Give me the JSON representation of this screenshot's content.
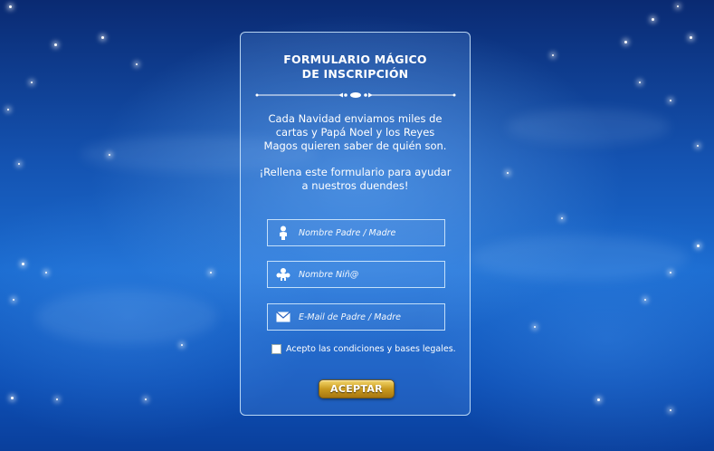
{
  "form": {
    "title_line1": "FORMULARIO MÁGICO",
    "title_line2": "DE INSCRIPCIÓN",
    "intro_paragraph1": "Cada Navidad enviamos miles de cartas y Papá Noel y los Reyes Magos quieren saber de quién son.",
    "intro_paragraph2": "¡Rellena este formulario para ayudar a nuestros duendes!",
    "fields": [
      {
        "placeholder": "Nombre Padre / Madre",
        "icon": "parent-icon",
        "value": ""
      },
      {
        "placeholder": "Nombre Niñ@",
        "icon": "child-icon",
        "value": ""
      },
      {
        "placeholder": "E-Mail de Padre / Madre",
        "icon": "envelope-icon",
        "value": ""
      }
    ],
    "terms_label": "Acepto las condiciones y bases legales.",
    "terms_checked": false,
    "submit_label": "ACEPTAR"
  },
  "colors": {
    "background_primary": "#1452b0",
    "panel_border": "#d2ebff",
    "button_gold": "#c99a1f",
    "text": "#ffffff"
  }
}
